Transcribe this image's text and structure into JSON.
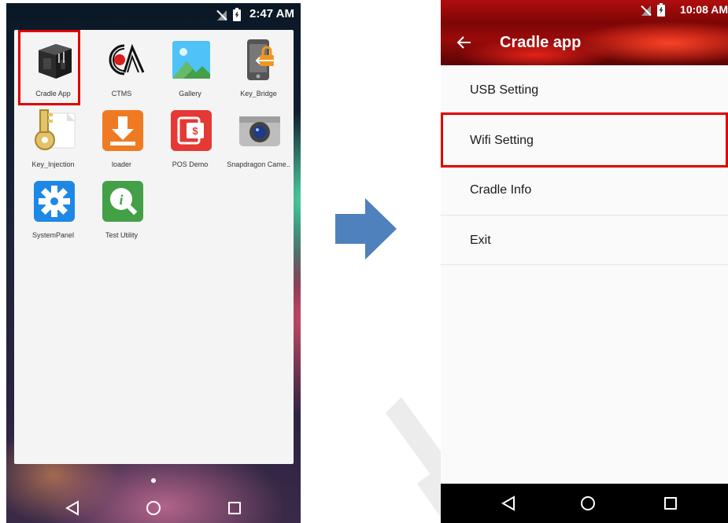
{
  "left_phone": {
    "status_time": "2:47 AM",
    "apps": [
      {
        "label": "Cradle App",
        "icon": "cradle-device-icon"
      },
      {
        "label": "CTMS",
        "icon": "ctms-logo-icon"
      },
      {
        "label": "Gallery",
        "icon": "gallery-icon"
      },
      {
        "label": "Key_Bridge",
        "icon": "key-bridge-icon"
      },
      {
        "label": "Key_Injection",
        "icon": "key-icon"
      },
      {
        "label": "loader",
        "icon": "download-icon"
      },
      {
        "label": "POS Demo",
        "icon": "pos-demo-icon"
      },
      {
        "label": "Snapdragon Came..",
        "icon": "camera-icon"
      },
      {
        "label": "SystemPanel",
        "icon": "gear-icon"
      },
      {
        "label": "Test Utility",
        "icon": "info-search-icon"
      }
    ]
  },
  "right_phone": {
    "status_time": "10:08 AM",
    "title": "Cradle app",
    "menu": [
      {
        "label": "USB Setting"
      },
      {
        "label": "Wifi Setting"
      },
      {
        "label": "Cradle Info"
      },
      {
        "label": "Exit"
      }
    ]
  },
  "colors": {
    "highlight": "#e00000",
    "arrow": "#4f81bd",
    "header_red": "#9a0b0b"
  }
}
